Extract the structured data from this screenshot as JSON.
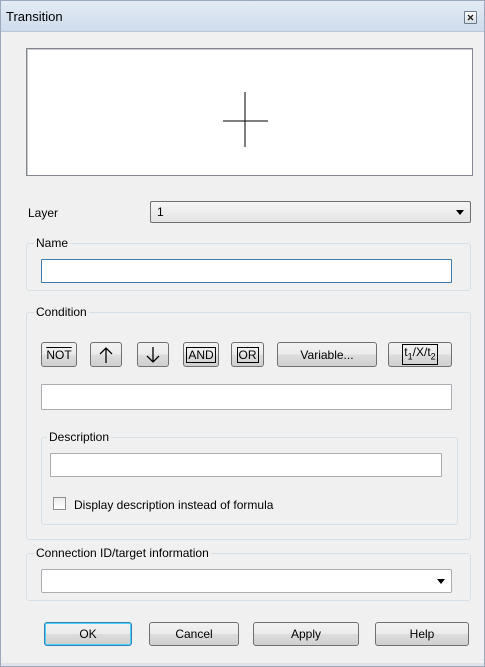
{
  "window": {
    "title": "Transition"
  },
  "layer": {
    "label": "Layer",
    "value": "1"
  },
  "name_group": {
    "title": "Name",
    "value": ""
  },
  "condition": {
    "title": "Condition",
    "buttons": {
      "not": "NOT",
      "and": "AND",
      "or": "OR",
      "variable": "Variable...",
      "timer": "t1/X/t2"
    },
    "formula": ""
  },
  "description": {
    "title": "Description",
    "value": "",
    "checkbox_label": "Display description instead of formula",
    "checked": false
  },
  "connection": {
    "title": "Connection ID/target information",
    "value": ""
  },
  "buttons": {
    "ok": "OK",
    "cancel": "Cancel",
    "apply": "Apply",
    "help": "Help"
  }
}
